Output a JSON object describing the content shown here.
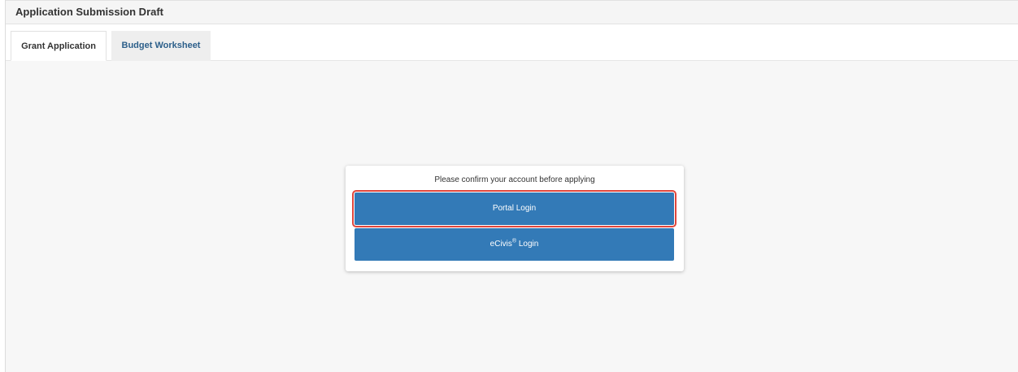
{
  "panel": {
    "title": "Application Submission Draft"
  },
  "tabs": [
    {
      "label": "Grant Application",
      "active": true
    },
    {
      "label": "Budget Worksheet",
      "active": false
    }
  ],
  "login_card": {
    "prompt": "Please confirm your account before applying",
    "portal_button": "Portal Login",
    "ecivis_button_prefix": "eCivis",
    "ecivis_button_mark": "®",
    "ecivis_button_suffix": " Login"
  },
  "colors": {
    "primary_button": "#337ab7",
    "highlight_outline": "#e0463c",
    "tab_link": "#2c5f8a"
  }
}
